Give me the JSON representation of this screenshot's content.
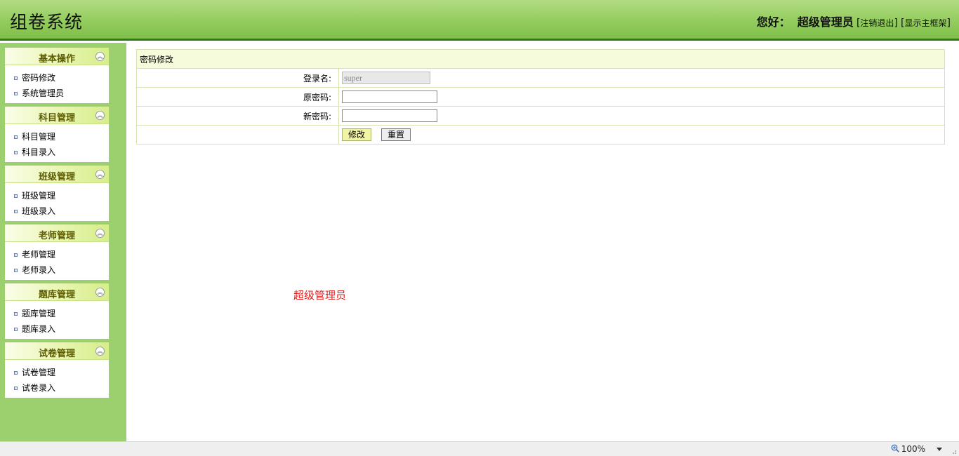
{
  "header": {
    "title": "组卷系统",
    "greeting": "您好：",
    "username": "超级管理员",
    "logout_label": "注销退出",
    "show_frame_label": "显示主框架"
  },
  "sidebar": {
    "groups": [
      {
        "title": "基本操作",
        "items": [
          "密码修改",
          "系统管理员"
        ]
      },
      {
        "title": "科目管理",
        "items": [
          "科目管理",
          "科目录入"
        ]
      },
      {
        "title": "班级管理",
        "items": [
          "班级管理",
          "班级录入"
        ]
      },
      {
        "title": "老师管理",
        "items": [
          "老师管理",
          "老师录入"
        ]
      },
      {
        "title": "题库管理",
        "items": [
          "题库管理",
          "题库录入"
        ]
      },
      {
        "title": "试卷管理",
        "items": [
          "试卷管理",
          "试卷录入"
        ]
      }
    ]
  },
  "form": {
    "caption": "密码修改",
    "login_label": "登录名:",
    "login_value": "super",
    "old_password_label": "原密码:",
    "old_password_value": "",
    "new_password_label": "新密码:",
    "new_password_value": "",
    "submit_label": "修改",
    "reset_label": "重置"
  },
  "main": {
    "role_text": "超级管理员"
  },
  "statusbar": {
    "zoom": "100%"
  },
  "colors": {
    "header_green": "#98cf64",
    "sidebar_green": "#9ccf6e",
    "role_red": "#e02020"
  }
}
